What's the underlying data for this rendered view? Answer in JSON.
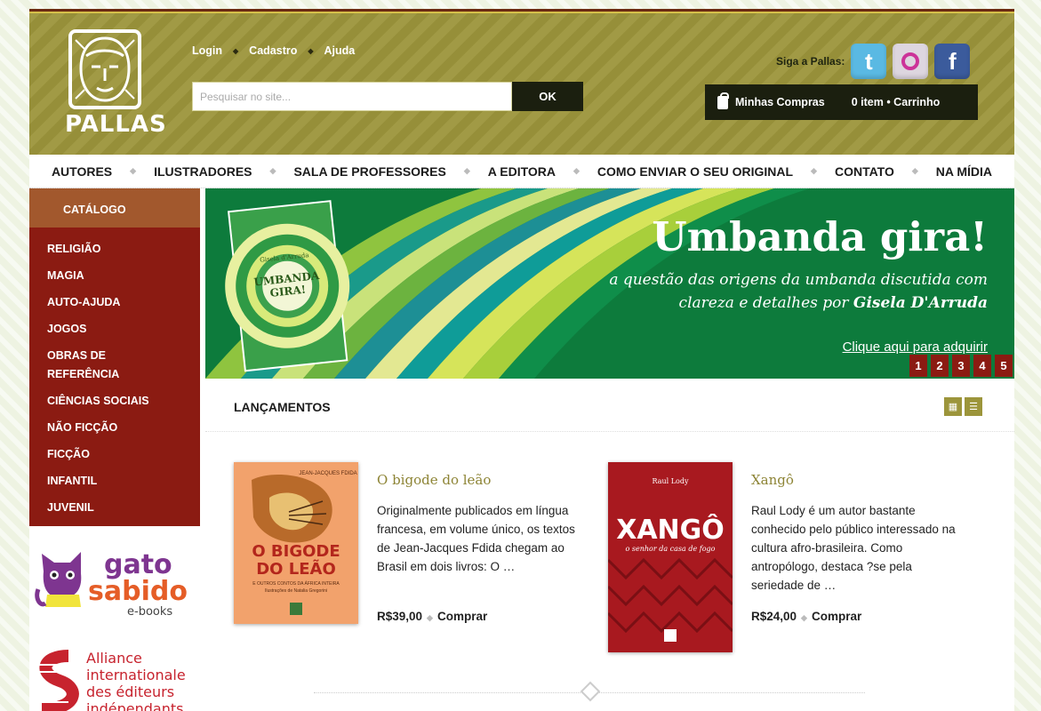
{
  "brand": {
    "name": "PALLAS"
  },
  "toplinks": [
    "Login",
    "Cadastro",
    "Ajuda"
  ],
  "search": {
    "placeholder": "Pesquisar no site...",
    "button": "OK"
  },
  "social": {
    "label": "Siga a Pallas:",
    "icons": [
      "twitter-icon",
      "orkut-icon",
      "facebook-icon"
    ]
  },
  "cart": {
    "label": "Minhas Compras",
    "count": "0 item • Carrinho"
  },
  "nav": [
    "AUTORES",
    "ILUSTRADORES",
    "SALA DE PROFESSORES",
    "A EDITORA",
    "COMO ENVIAR O SEU ORIGINAL",
    "CONTATO",
    "NA MÍDIA"
  ],
  "catalog": {
    "title": "CATÁLOGO",
    "items": [
      "RELIGIÃO",
      "MAGIA",
      "AUTO-AJUDA",
      "JOGOS",
      "OBRAS DE REFERÊNCIA",
      "CIÊNCIAS SOCIAIS",
      "NÃO FICÇÃO",
      "FICÇÃO",
      "INFANTIL",
      "JUVENIL"
    ]
  },
  "partners": {
    "gato": {
      "line1": "gato",
      "line2": "sabido",
      "line3": "e-books"
    },
    "alliance": {
      "line1": "Alliance",
      "line2": "internationale",
      "line3": "des éditeurs",
      "line4": "indépendants"
    }
  },
  "banner": {
    "title": "Umbanda gira!",
    "subtitle_a": "a questão das origens da umbanda discutida com clareza e detalhes por ",
    "subtitle_author": "Gisela D'Arruda",
    "link": "Clique aqui para adquirir",
    "cover_author": "Gisela d'Arruda",
    "cover_title_1": "UMBANDA",
    "cover_title_2": "GIRA!",
    "pages": [
      "1",
      "2",
      "3",
      "4",
      "5"
    ]
  },
  "launches": {
    "heading": "LANÇAMENTOS",
    "books": [
      {
        "title": "O bigode do leão",
        "description": "Originalmente publicados em língua francesa, em volume único, os textos de Jean-Jacques Fdida chegam ao Brasil em dois livros: O …",
        "price": "R$39,00",
        "buy": "Comprar",
        "cover_author": "JEAN-JACQUES FDIDA",
        "cover_title_1": "O BIGODE",
        "cover_title_2": "DO LEÃO",
        "cover_sub": "E OUTROS CONTOS DA ÁFRICA INTEIRA",
        "cover_illus": "Ilustrações de Natalia Gregorini"
      },
      {
        "title": "Xangô",
        "description": "Raul Lody é um autor bastante conhecido pelo público interessado na cultura afro-brasileira. Como antropólogo, destaca ?se pela seriedade de …",
        "price": "R$24,00",
        "buy": "Comprar",
        "cover_author": "Raul Lody",
        "cover_title": "XANGÔ",
        "cover_sub": "o senhor da casa de fogo"
      }
    ]
  },
  "colors": {
    "header": "#9c953b",
    "catalog": "#8b1b12",
    "banner": "#0d7b3c",
    "accent": "#8d8435"
  }
}
